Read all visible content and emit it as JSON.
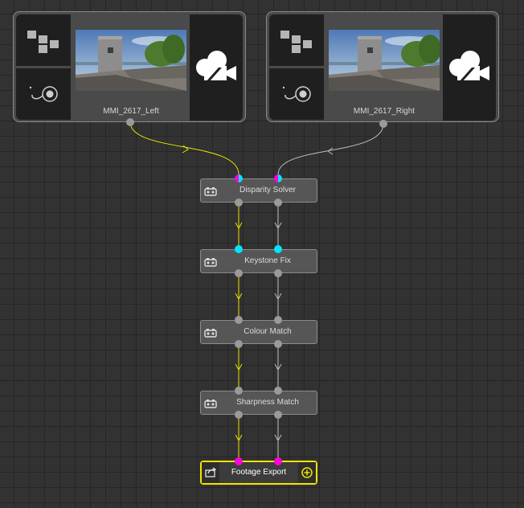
{
  "sources": {
    "left": {
      "name": "MMI_2617_Left"
    },
    "right": {
      "name": "MMI_2617_Right"
    }
  },
  "nodes": [
    {
      "label": "Disparity Solver",
      "icon": "camera-pair-icon"
    },
    {
      "label": "Keystone Fix",
      "icon": "camera-pair-icon"
    },
    {
      "label": "Colour Match",
      "icon": "camera-pair-icon"
    },
    {
      "label": "Sharpness Match",
      "icon": "camera-pair-icon"
    }
  ],
  "output": {
    "label": "Footage Export",
    "icon": "export-icon",
    "add_icon": "add-output-icon"
  },
  "colors": {
    "canvas": "#323232",
    "left_wire": "#e8e000",
    "right_wire": "#bdbdbd",
    "port_cyan": "#00e5ff",
    "port_magenta": "#ff00dd",
    "port_grey": "#9a9a9a",
    "export_border": "#f2e600"
  }
}
